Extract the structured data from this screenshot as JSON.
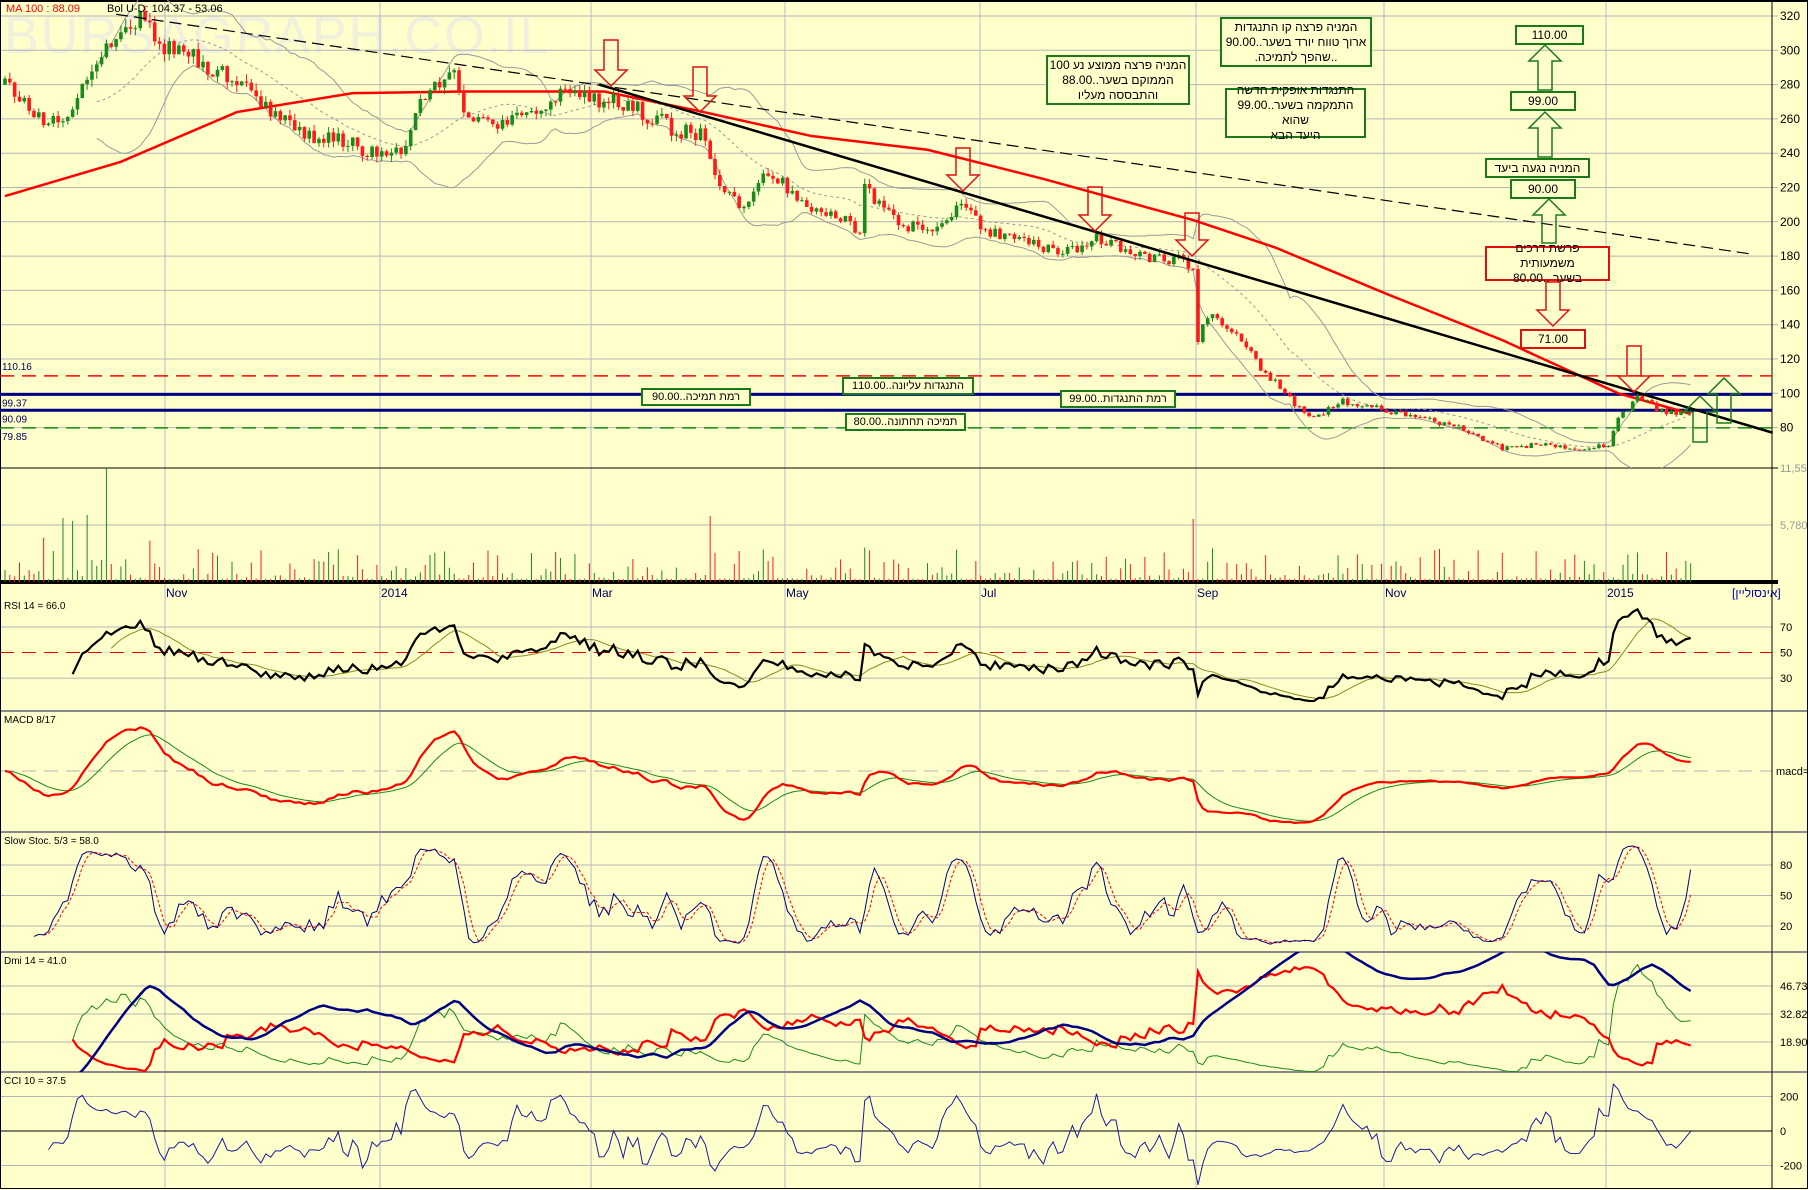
{
  "watermark": "BURSAGRAPH.CO.IL",
  "legend": {
    "ma": "MA 100 : 88.09",
    "bol": "Bol U-D: 104.37 - 53.06"
  },
  "axis_right_price": [
    "320",
    "300",
    "280",
    "260",
    "240",
    "220",
    "200",
    "180",
    "160",
    "140",
    "120",
    "100",
    "80"
  ],
  "volume_axis": [
    "11,559",
    "5,780"
  ],
  "left_levels": [
    "110.16",
    "99.37",
    "90.09",
    "79.85"
  ],
  "months": [
    "Nov",
    "2014",
    "Mar",
    "May",
    "Jul",
    "Sep",
    "Nov",
    "2015"
  ],
  "security_name": "[אינסוליין]",
  "indicators": {
    "rsi": {
      "label": "RSI 14 = 66.0",
      "ticks": [
        "70",
        "50",
        "30"
      ]
    },
    "macd": {
      "label": "MACD 8/17",
      "ticks": [
        "macd=0"
      ]
    },
    "stoch": {
      "label": "Slow Stoc. 5/3 = 58.0",
      "ticks": [
        "80",
        "50",
        "20"
      ]
    },
    "dmi": {
      "label": "Dmi 14 = 41.0",
      "ticks": [
        "46.73",
        "32.82",
        "18.90"
      ]
    },
    "cci": {
      "label": "CCI 10 = 37.5",
      "ticks": [
        "200",
        "0",
        "-200"
      ]
    }
  },
  "annotations": {
    "ma_break": [
      "המניה פרצה ממוצע נע 100",
      "הממוקם בשער..88.00",
      "והתבססה מעליו"
    ],
    "trend_break": [
      "המניה פרצה קו התנגדות",
      "ארוך טווח יורד בשער..90.00",
      "..שהפך לתמיכה."
    ],
    "new_resistance": [
      "התנגדות אופקית חדשה",
      "התמקמה בשער..99.00 שהוא",
      "היעד הבא"
    ],
    "target_110": "110.00",
    "target_99": "99.00",
    "reached": "המניה נגעה ביעד",
    "target_90": "90.00",
    "crossroads": [
      "פרשת דרכים משמעותית",
      "בשער ..80.00"
    ],
    "target_71": "71.00",
    "upper_resistance": "התנגדות עליונה..110.00",
    "support_level": "רמת תמיכה..90.00",
    "resistance_level": "רמת התנגדות..99.00",
    "lower_support": "תמיכה תחתונה..80.00"
  },
  "colors": {
    "bg": "#ffffcc",
    "up": "#1a8a1a",
    "down": "#ff1a1a",
    "ma": "#ff0000",
    "navy": "#000080",
    "grid": "#b4b4b4"
  },
  "chart_data": {
    "type": "candlestick",
    "title": "Insuline daily, Sep 2013 - Feb 2015",
    "x_unit": "trading-day index",
    "ylim": [
      70,
      325
    ],
    "close_path": [
      [
        0,
        280
      ],
      [
        5,
        265
      ],
      [
        12,
        255
      ],
      [
        14,
        270
      ],
      [
        19,
        295
      ],
      [
        24,
        315
      ],
      [
        29,
        318
      ],
      [
        32,
        300
      ],
      [
        36,
        305
      ],
      [
        41,
        290
      ],
      [
        48,
        285
      ],
      [
        57,
        260
      ],
      [
        64,
        250
      ],
      [
        72,
        245
      ],
      [
        79,
        235
      ],
      [
        84,
        250
      ],
      [
        86,
        270
      ],
      [
        93,
        285
      ],
      [
        95,
        265
      ],
      [
        100,
        255
      ],
      [
        107,
        260
      ],
      [
        115,
        275
      ],
      [
        122,
        272
      ],
      [
        129,
        268
      ],
      [
        138,
        255
      ],
      [
        144,
        250
      ],
      [
        148,
        220
      ],
      [
        153,
        210
      ],
      [
        158,
        230
      ],
      [
        162,
        220
      ],
      [
        167,
        210
      ],
      [
        172,
        205
      ],
      [
        177,
        195
      ],
      [
        178,
        220
      ],
      [
        184,
        200
      ],
      [
        191,
        195
      ],
      [
        198,
        210
      ],
      [
        203,
        195
      ],
      [
        210,
        188
      ],
      [
        220,
        183
      ],
      [
        226,
        190
      ],
      [
        229,
        188
      ],
      [
        239,
        178
      ],
      [
        243,
        178
      ],
      [
        246,
        170
      ],
      [
        247,
        130
      ],
      [
        249,
        145
      ],
      [
        255,
        135
      ],
      [
        260,
        115
      ],
      [
        265,
        100
      ],
      [
        270,
        85
      ],
      [
        277,
        95
      ],
      [
        286,
        90
      ],
      [
        294,
        85
      ],
      [
        301,
        80
      ],
      [
        310,
        68
      ],
      [
        317,
        70
      ],
      [
        327,
        68
      ],
      [
        332,
        70
      ],
      [
        334,
        85
      ],
      [
        338,
        98
      ],
      [
        344,
        88
      ],
      [
        349,
        90
      ]
    ],
    "ma100_path": [
      [
        0,
        215
      ],
      [
        24,
        235
      ],
      [
        48,
        264
      ],
      [
        72,
        275
      ],
      [
        95,
        276
      ],
      [
        124,
        276
      ],
      [
        143,
        265
      ],
      [
        167,
        250
      ],
      [
        191,
        242
      ],
      [
        215,
        225
      ],
      [
        246,
        201
      ],
      [
        263,
        185
      ],
      [
        286,
        158
      ],
      [
        310,
        131
      ],
      [
        334,
        100
      ],
      [
        349,
        88
      ]
    ],
    "trendlines": [
      {
        "name": "short-term downtrend",
        "style": "solid",
        "from": [
          123,
          280
        ],
        "to": [
          366,
          77
        ]
      },
      {
        "name": "long-term downtrend",
        "style": "dashed",
        "from": [
          23,
          321
        ],
        "to": [
          362,
          181
        ]
      }
    ],
    "levels": [
      {
        "value": 110.16,
        "style": "red-dashed"
      },
      {
        "value": 99.37,
        "style": "navy"
      },
      {
        "value": 90.09,
        "style": "navy"
      },
      {
        "value": 79.85,
        "style": "green-dashed"
      }
    ],
    "volume_max": 11559,
    "volume_spikes": [
      [
        8,
        4500
      ],
      [
        12,
        6500
      ],
      [
        14,
        6200
      ],
      [
        17,
        6800
      ],
      [
        21,
        11559
      ],
      [
        30,
        4200
      ],
      [
        146,
        6700
      ],
      [
        178,
        3500
      ],
      [
        246,
        6400
      ],
      [
        338,
        3000
      ]
    ],
    "last": {
      "ma100": 88.09,
      "bol_upper": 104.37,
      "bol_lower": 53.06,
      "rsi": 66.0,
      "stoch": 58.0,
      "dmi": 41.0,
      "cci": 37.5
    }
  }
}
